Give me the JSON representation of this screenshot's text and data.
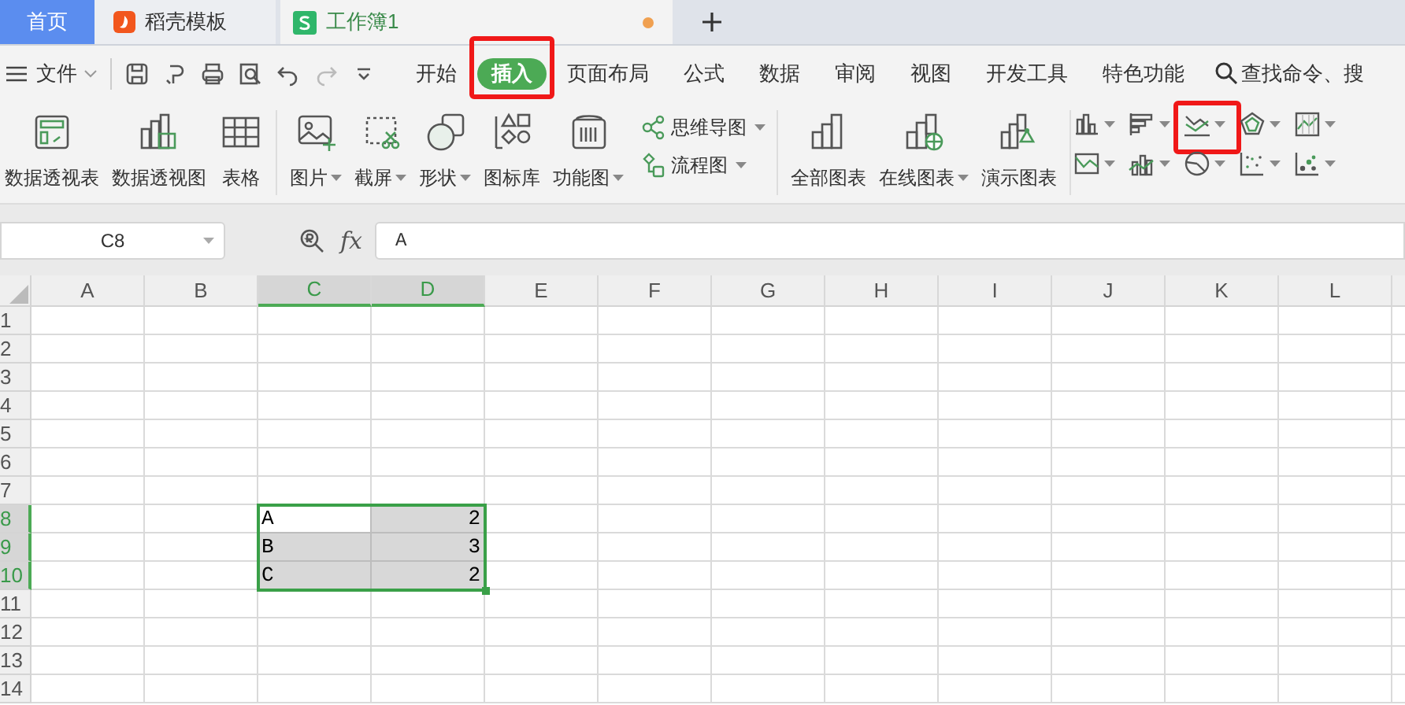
{
  "tabs": [
    {
      "kind": "home",
      "label": "首页",
      "selected": false
    },
    {
      "kind": "docer",
      "label": "稻壳模板",
      "selected": false
    },
    {
      "kind": "sheet",
      "label": "工作簿1",
      "selected": true,
      "unsaved": true
    }
  ],
  "menu": {
    "file": "文件",
    "tabs": [
      {
        "label": "开始",
        "selected": false,
        "highlighted": false
      },
      {
        "label": "插入",
        "selected": true,
        "highlighted": true
      },
      {
        "label": "页面布局",
        "selected": false,
        "highlighted": false
      },
      {
        "label": "公式",
        "selected": false,
        "highlighted": false
      },
      {
        "label": "数据",
        "selected": false,
        "highlighted": false
      },
      {
        "label": "审阅",
        "selected": false,
        "highlighted": false
      },
      {
        "label": "视图",
        "selected": false,
        "highlighted": false
      },
      {
        "label": "开发工具",
        "selected": false,
        "highlighted": false
      },
      {
        "label": "特色功能",
        "selected": false,
        "highlighted": false
      }
    ],
    "search": "查找命令、搜"
  },
  "ribbon": {
    "groups": [
      [
        {
          "kind": "pivot-table",
          "label": "数据透视表",
          "dropdown": false
        },
        {
          "kind": "pivot-chart",
          "label": "数据透视图",
          "dropdown": false
        },
        {
          "kind": "table",
          "label": "表格",
          "dropdown": false
        }
      ],
      [
        {
          "kind": "picture",
          "label": "图片",
          "dropdown": true
        },
        {
          "kind": "screenshot",
          "label": "截屏",
          "dropdown": true
        },
        {
          "kind": "shape",
          "label": "形状",
          "dropdown": true
        },
        {
          "kind": "icon-library",
          "label": "图标库",
          "dropdown": false
        },
        {
          "kind": "function-chart",
          "label": "功能图",
          "dropdown": true
        }
      ],
      [
        {
          "kind": "all-charts",
          "label": "全部图表",
          "dropdown": false
        },
        {
          "kind": "online-chart",
          "label": "在线图表",
          "dropdown": true
        },
        {
          "kind": "demo-chart",
          "label": "演示图表",
          "dropdown": false
        }
      ]
    ],
    "small_buttons": [
      {
        "kind": "mind-map",
        "label": "思维导图"
      },
      {
        "kind": "flowchart",
        "label": "流程图"
      }
    ],
    "chart_types": [
      {
        "kind": "column",
        "highlighted": false
      },
      {
        "kind": "bar",
        "highlighted": false
      },
      {
        "kind": "line",
        "highlighted": true
      },
      {
        "kind": "radar",
        "highlighted": false
      },
      {
        "kind": "stock",
        "highlighted": false
      },
      {
        "kind": "area",
        "highlighted": false
      },
      {
        "kind": "combo",
        "highlighted": false
      },
      {
        "kind": "pie",
        "highlighted": false
      },
      {
        "kind": "scatter",
        "highlighted": false
      },
      {
        "kind": "bubble",
        "highlighted": false
      }
    ]
  },
  "formula_bar": {
    "cell_ref": "C8",
    "function_label": "fx",
    "formula": "A"
  },
  "sheet": {
    "columns": [
      {
        "label": "A",
        "selected": false
      },
      {
        "label": "B",
        "selected": false
      },
      {
        "label": "C",
        "selected": true
      },
      {
        "label": "D",
        "selected": true
      },
      {
        "label": "E",
        "selected": false
      },
      {
        "label": "F",
        "selected": false
      },
      {
        "label": "G",
        "selected": false
      },
      {
        "label": "H",
        "selected": false
      },
      {
        "label": "I",
        "selected": false
      },
      {
        "label": "J",
        "selected": false
      },
      {
        "label": "K",
        "selected": false
      },
      {
        "label": "L",
        "selected": false
      }
    ],
    "rows": [
      {
        "label": "1",
        "selected": false
      },
      {
        "label": "2",
        "selected": false
      },
      {
        "label": "3",
        "selected": false
      },
      {
        "label": "4",
        "selected": false
      },
      {
        "label": "5",
        "selected": false
      },
      {
        "label": "6",
        "selected": false
      },
      {
        "label": "7",
        "selected": false
      },
      {
        "label": "8",
        "selected": true,
        "cells": [
          {
            "value": "A",
            "kind": "text",
            "active": true
          },
          {
            "value": "2",
            "kind": "number",
            "active": false
          }
        ]
      },
      {
        "label": "9",
        "selected": true,
        "cells": [
          {
            "value": "B",
            "kind": "text",
            "active": false
          },
          {
            "value": "3",
            "kind": "number",
            "active": false
          }
        ]
      },
      {
        "label": "10",
        "selected": true,
        "cells": [
          {
            "value": "C",
            "kind": "text",
            "active": false
          },
          {
            "value": "2",
            "kind": "number",
            "active": false
          }
        ]
      },
      {
        "label": "11",
        "selected": false
      },
      {
        "label": "12",
        "selected": false
      },
      {
        "label": "13",
        "selected": false
      },
      {
        "label": "14",
        "selected": false
      }
    ]
  }
}
